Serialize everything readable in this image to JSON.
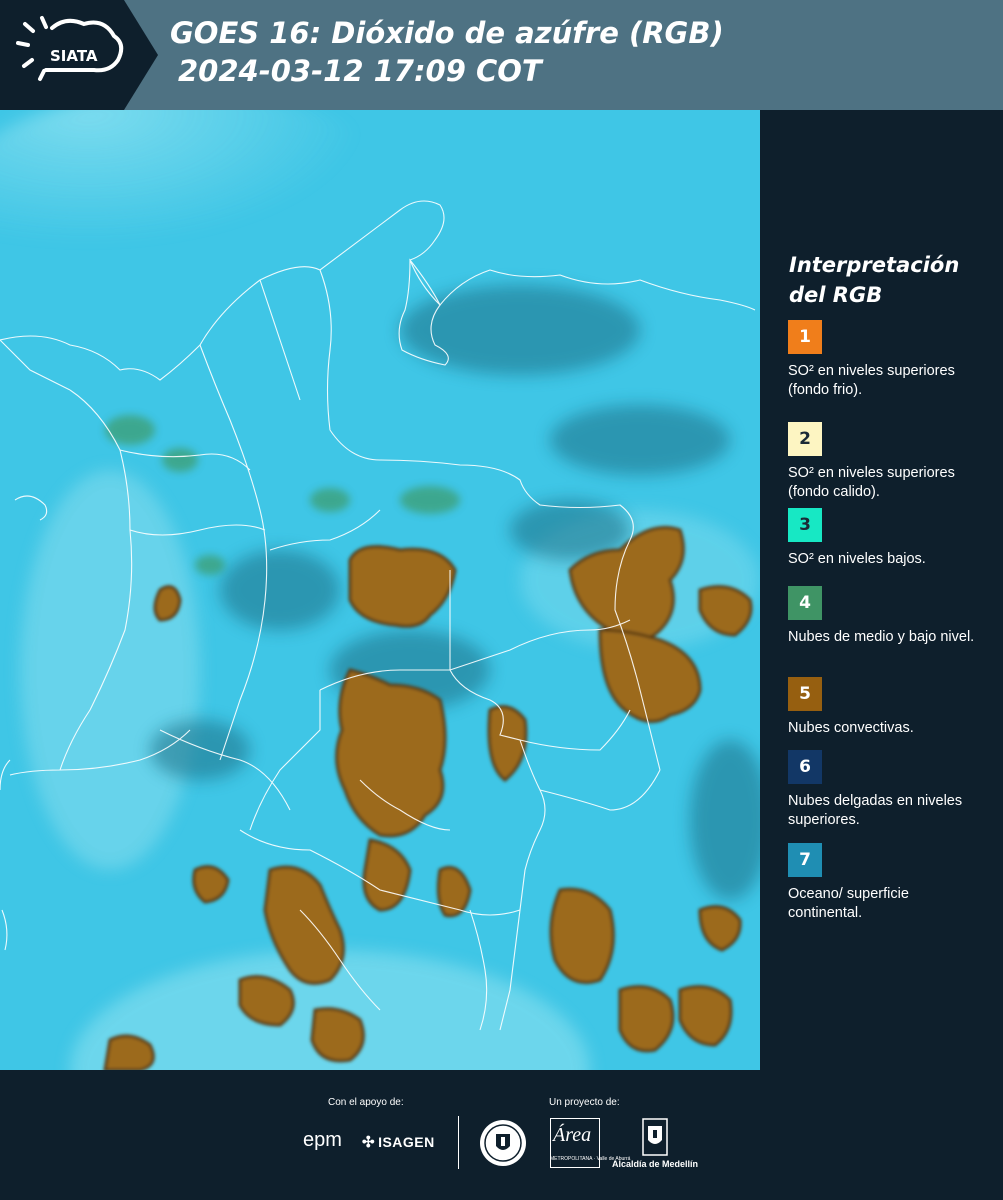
{
  "header": {
    "logo_text": "SIATA",
    "title_line1": "GOES 16: Dióxido de azúfre (RGB)",
    "title_line2": "2024-03-12 17:09 COT",
    "background_color": "#4e7283"
  },
  "legend": {
    "title_line1": "Interpretación",
    "title_line2": "del RGB",
    "items": [
      {
        "number": "1",
        "color": "#f07e1b",
        "number_color": "#ffffff",
        "label": "SO² en niveles superiores (fondo frio)."
      },
      {
        "number": "2",
        "color": "#fdf5c2",
        "number_color": "#1b2a36",
        "label": "SO² en niveles superiores (fondo calido)."
      },
      {
        "number": "3",
        "color": "#17e8c4",
        "number_color": "#1b2a36",
        "label": "SO² en niveles bajos."
      },
      {
        "number": "4",
        "color": "#3f9465",
        "number_color": "#ffffff",
        "label": "Nubes de medio y bajo nivel."
      },
      {
        "number": "5",
        "color": "#965f10",
        "number_color": "#ffffff",
        "label": "Nubes convectivas."
      },
      {
        "number": "6",
        "color": "#123766",
        "number_color": "#ffffff",
        "label": "Nubes delgadas en niveles superiores."
      },
      {
        "number": "7",
        "color": "#1f8eb3",
        "number_color": "#ffffff",
        "label": "Oceano/ superficie continental."
      }
    ]
  },
  "footer": {
    "support_caption": "Con el apoyo de:",
    "project_caption": "Un proyecto de:",
    "sponsor_epm": "epm",
    "sponsor_isagen": "ISAGEN",
    "area_logo_word": "Área",
    "area_logo_subtext": "METROPOLITANA · Valle de Aburrá",
    "alcaldia_text": "Alcaldía de Medellín"
  },
  "map": {
    "background_color": "#3fc6e6",
    "convective_color": "#9c6a1e",
    "border_color": "#ffffff"
  }
}
